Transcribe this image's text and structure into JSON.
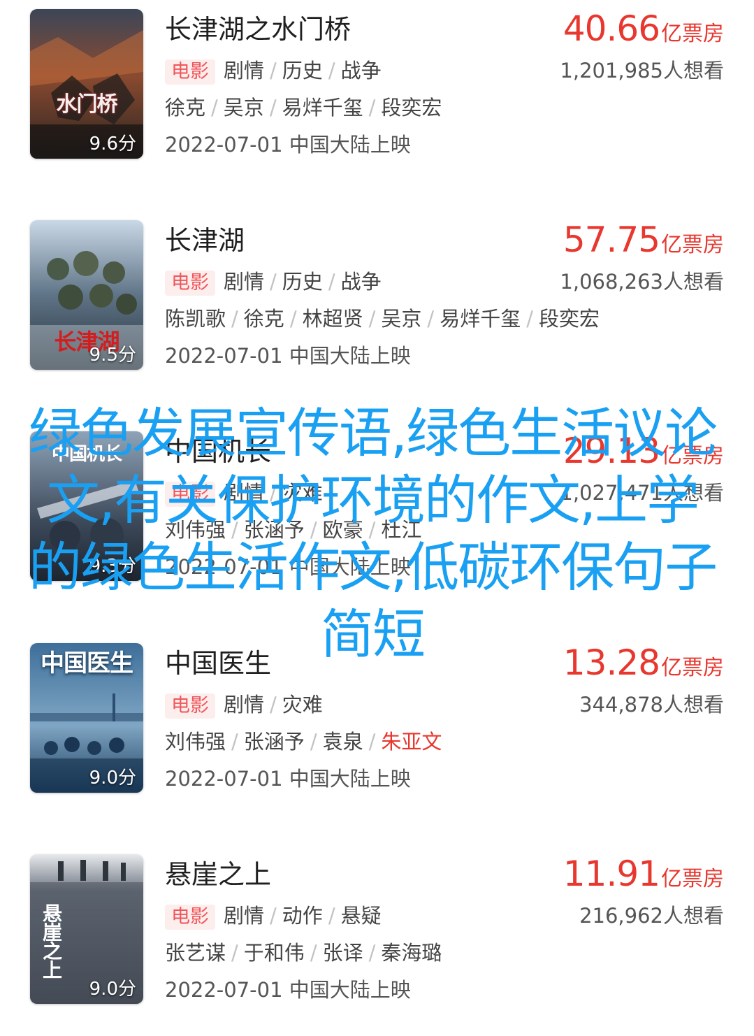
{
  "overlay": {
    "headline": "绿色发展宣传语,绿色生活议论文,有关保护环境的作文,上学的绿色生活作文,低碳环保句子简短",
    "color": "#1aa0f2"
  },
  "theme": {
    "accent": "#e8372e",
    "tag_bg": "#fdeeee"
  },
  "movies": [
    {
      "title": "长津湖之水门桥",
      "type_tag": "电影",
      "genres": [
        "剧情",
        "历史",
        "战争"
      ],
      "cast": [
        "徐克",
        "吴京",
        "易烊千玺",
        "段奕宏"
      ],
      "release": "2022-07-01 中国大陆上映",
      "box_office_value": "40.66",
      "box_office_unit": "亿票房",
      "want_count": "1,201,985人想看",
      "score": "9.6分",
      "poster_title": "水门桥"
    },
    {
      "title": "长津湖",
      "type_tag": "电影",
      "genres": [
        "剧情",
        "历史",
        "战争"
      ],
      "cast": [
        "陈凯歌",
        "徐克",
        "林超贤",
        "吴京",
        "易烊千玺",
        "段奕宏"
      ],
      "release": "2022-07-01 中国大陆上映",
      "box_office_value": "57.75",
      "box_office_unit": "亿票房",
      "want_count": "1,068,263人想看",
      "score": "9.5分",
      "poster_title": "长津湖"
    },
    {
      "title": "中国机长",
      "type_tag": "电影",
      "genres": [
        "剧情",
        "灾难"
      ],
      "cast": [
        "刘伟强",
        "张涵予",
        "欧豪",
        "杜江"
      ],
      "release": "2022-07-01 中国大陆上映",
      "box_office_value": "29.13",
      "box_office_unit": "亿票房",
      "want_count": "1,027,471人想看",
      "score": "9.3分",
      "poster_title": "中国机长"
    },
    {
      "title": "中国医生",
      "type_tag": "电影",
      "genres": [
        "剧情",
        "灾难"
      ],
      "cast": [
        "刘伟强",
        "张涵予",
        "袁泉",
        "朱亚文"
      ],
      "release": "2022-07-01 中国大陆上映",
      "box_office_value": "13.28",
      "box_office_unit": "亿票房",
      "want_count": "344,878人想看",
      "score": "9.0分",
      "poster_title": "中国医生"
    },
    {
      "title": "悬崖之上",
      "type_tag": "电影",
      "genres": [
        "剧情",
        "动作",
        "悬疑"
      ],
      "cast": [
        "张艺谋",
        "于和伟",
        "张译",
        "秦海璐"
      ],
      "release": "2022-07-01 中国大陆上映",
      "box_office_value": "11.91",
      "box_office_unit": "亿票房",
      "want_count": "216,962人想看",
      "score": "9.0分",
      "poster_title": "悬崖之上"
    }
  ]
}
